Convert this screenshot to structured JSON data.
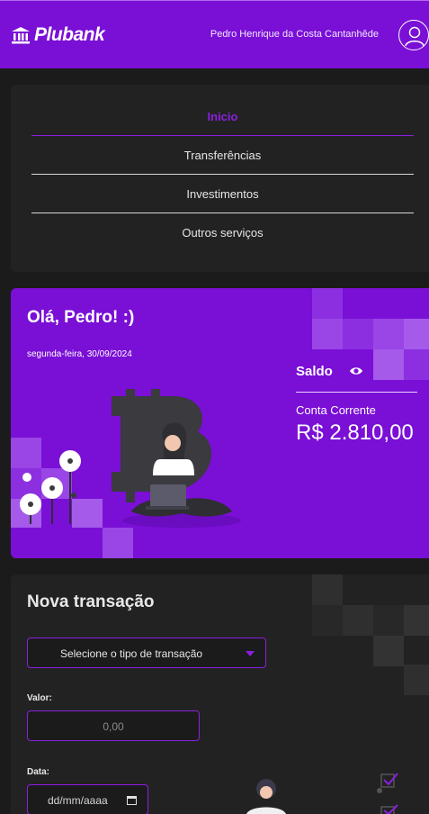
{
  "header": {
    "brand": "Plubank",
    "user_name": "Pedro Henrique da Costa Cantanhêde",
    "colors": {
      "primary": "#7a0fd6",
      "accent": "#8b1fe0",
      "background": "#1b1b1b",
      "card": "#222222"
    }
  },
  "nav": {
    "items": [
      {
        "label": "Inicio",
        "active": true
      },
      {
        "label": "Transferências",
        "active": false
      },
      {
        "label": "Investimentos",
        "active": false
      },
      {
        "label": "Outros serviços",
        "active": false
      }
    ]
  },
  "hero": {
    "greeting": "Olá, Pedro! :)",
    "date": "segunda-feira, 30/09/2024",
    "balance_label": "Saldo",
    "account_label": "Conta Corrente",
    "balance_value": "R$ 2.810,00",
    "icons": {
      "visibility": "eye-icon"
    }
  },
  "transaction": {
    "title": "Nova transação",
    "type_placeholder": "Selecione o tipo de transação",
    "value_label": "Valor:",
    "value_placeholder": "0,00",
    "date_label": "Data:",
    "date_placeholder": "dd/mm/aaaa"
  }
}
